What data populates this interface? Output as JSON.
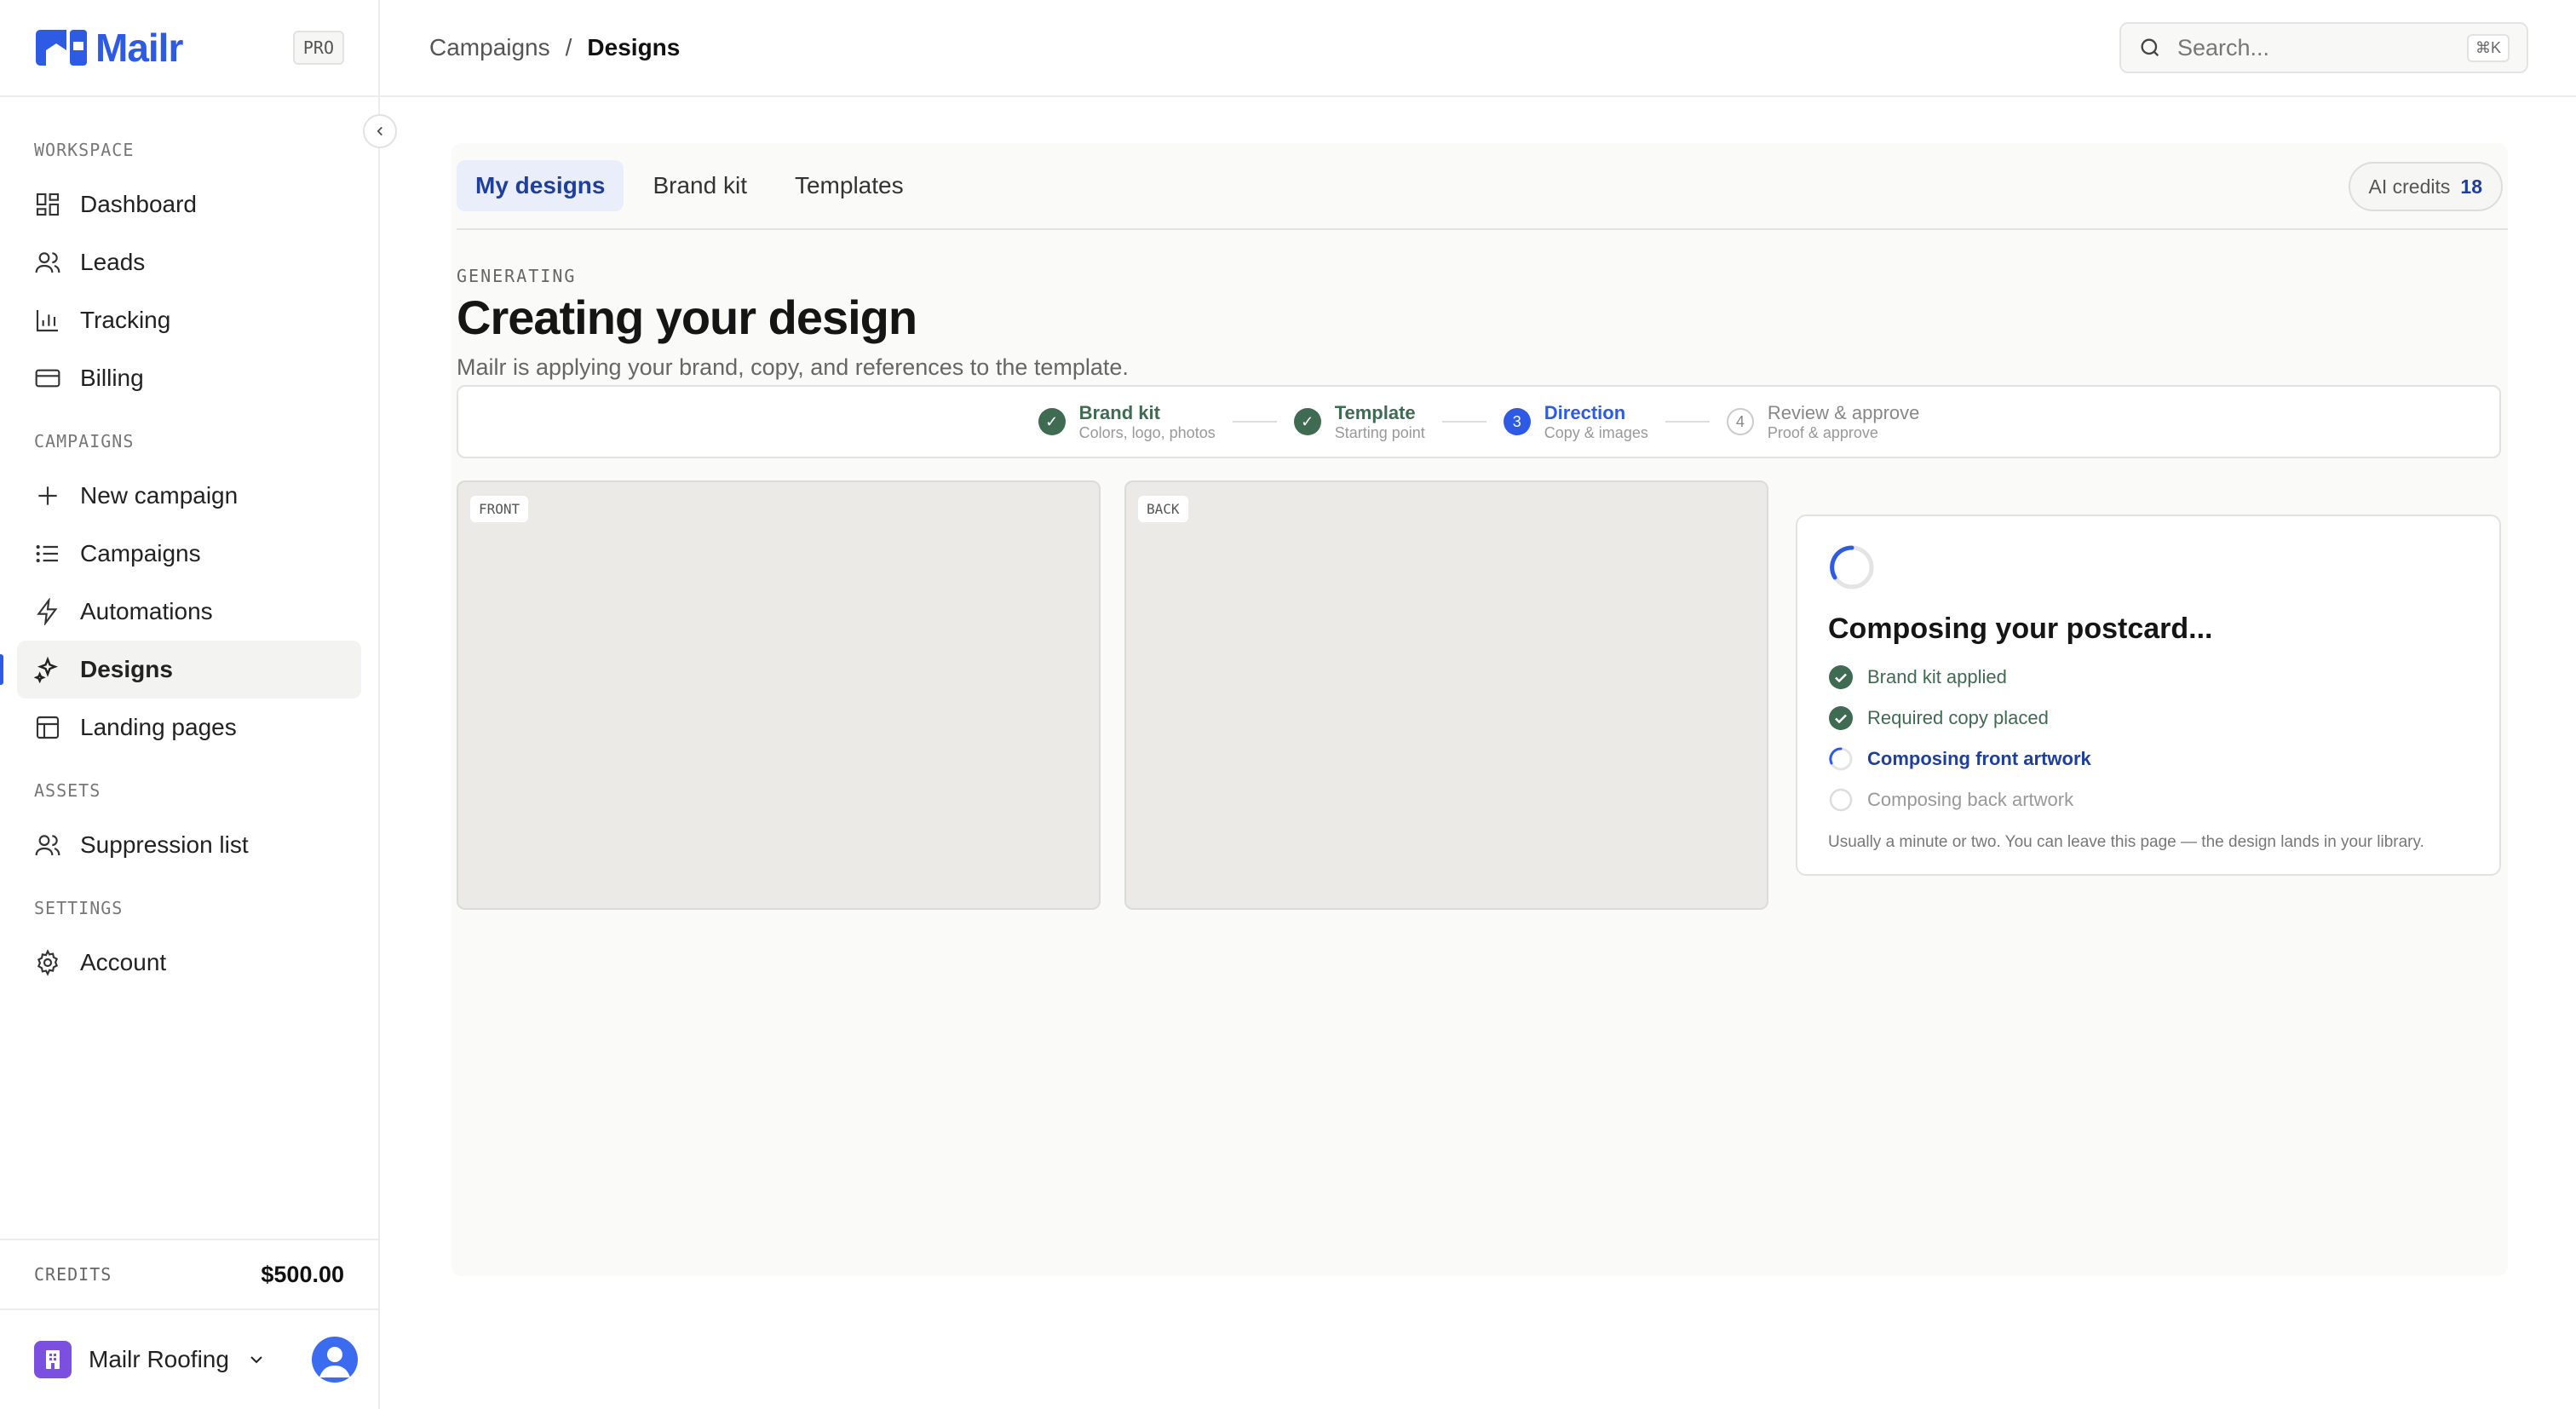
{
  "app": {
    "name": "Mailr",
    "plan_badge": "PRO"
  },
  "sidebar": {
    "sections": [
      {
        "label": "WORKSPACE",
        "items": [
          {
            "label": "Dashboard",
            "icon": "dashboard-icon"
          },
          {
            "label": "Leads",
            "icon": "users-icon"
          },
          {
            "label": "Tracking",
            "icon": "bar-chart-icon"
          },
          {
            "label": "Billing",
            "icon": "credit-card-icon"
          }
        ]
      },
      {
        "label": "CAMPAIGNS",
        "items": [
          {
            "label": "New campaign",
            "icon": "plus-icon"
          },
          {
            "label": "Campaigns",
            "icon": "list-icon"
          },
          {
            "label": "Automations",
            "icon": "lightning-icon"
          },
          {
            "label": "Designs",
            "icon": "sparkles-icon",
            "active": true
          },
          {
            "label": "Landing pages",
            "icon": "layout-icon"
          }
        ]
      },
      {
        "label": "ASSETS",
        "items": [
          {
            "label": "Suppression list",
            "icon": "users-icon"
          }
        ]
      },
      {
        "label": "SETTINGS",
        "items": [
          {
            "label": "Account",
            "icon": "gear-icon"
          }
        ]
      }
    ],
    "credits": {
      "label": "CREDITS",
      "value": "$500.00"
    },
    "account": {
      "org_name": "Mailr Roofing"
    }
  },
  "topbar": {
    "breadcrumb": [
      "Campaigns",
      "Designs"
    ],
    "search": {
      "placeholder": "Search...",
      "shortcut": "⌘K"
    }
  },
  "main": {
    "tabs": [
      {
        "label": "My designs",
        "active": true
      },
      {
        "label": "Brand kit"
      },
      {
        "label": "Templates"
      }
    ],
    "ai_credits": {
      "label": "AI credits",
      "value": "18"
    },
    "eyebrow": "GENERATING",
    "title": "Creating your design",
    "subtitle": "Mailr is applying your brand, copy, and references to the template.",
    "steps": [
      {
        "title": "Brand kit",
        "sub": "Colors, logo, photos",
        "state": "done",
        "marker": "✓"
      },
      {
        "title": "Template",
        "sub": "Starting point",
        "state": "done",
        "marker": "✓"
      },
      {
        "title": "Direction",
        "sub": "Copy & images",
        "state": "current",
        "marker": "3"
      },
      {
        "title": "Review & approve",
        "sub": "Proof & approve",
        "state": "todo",
        "marker": "4"
      }
    ],
    "previews": {
      "front": "FRONT",
      "back": "BACK"
    },
    "status": {
      "title": "Composing your postcard...",
      "items": [
        {
          "label": "Brand kit applied",
          "state": "done"
        },
        {
          "label": "Required copy placed",
          "state": "done"
        },
        {
          "label": "Composing front artwork",
          "state": "active"
        },
        {
          "label": "Composing back artwork",
          "state": "pending"
        }
      ],
      "note": "Usually a minute or two. You can leave this page — the design lands in your library."
    }
  },
  "colors": {
    "accent": "#2d5be3",
    "success": "#3f6b52",
    "org": "#7b4fe0"
  }
}
